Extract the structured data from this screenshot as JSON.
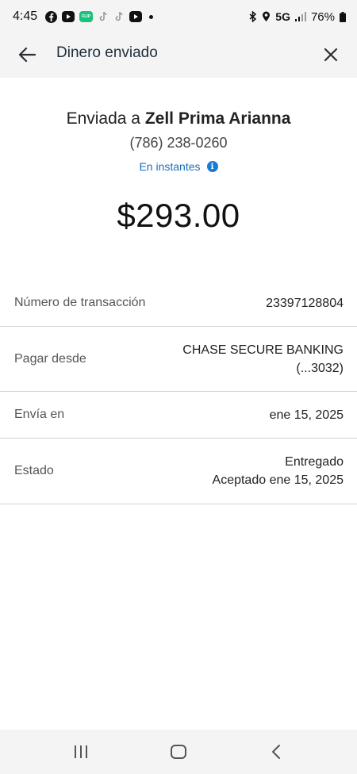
{
  "status_bar": {
    "time": "4:45",
    "network": "5G",
    "battery": "76%",
    "icons": [
      "facebook-icon",
      "youtube-icon",
      "fliip-app-icon",
      "tiktok-icon",
      "tiktok-icon",
      "youtube-icon",
      "notification-dot"
    ],
    "app_badge_text": "FLIP"
  },
  "header": {
    "title": "Dinero enviado"
  },
  "summary": {
    "sent_prefix": "Enviada a ",
    "recipient": "Zell Prima Arianna",
    "phone": "(786) 238-0260",
    "speed": "En instantes",
    "amount": "$293.00"
  },
  "details": {
    "rows": [
      {
        "label": "Número de transacción",
        "value": "23397128804"
      },
      {
        "label": "Pagar desde",
        "value_line1": "CHASE SECURE BANKING",
        "value_line2": "(...3032)"
      },
      {
        "label": "Envía en",
        "value": "ene 15, 2025"
      },
      {
        "label": "Estado",
        "value_line1": "Entregado",
        "value_line2": "Aceptado ene 15, 2025"
      }
    ]
  },
  "colors": {
    "bar_background": "#f4f4f4",
    "link_blue": "#1a6fb8",
    "divider": "#cfd3d6"
  }
}
